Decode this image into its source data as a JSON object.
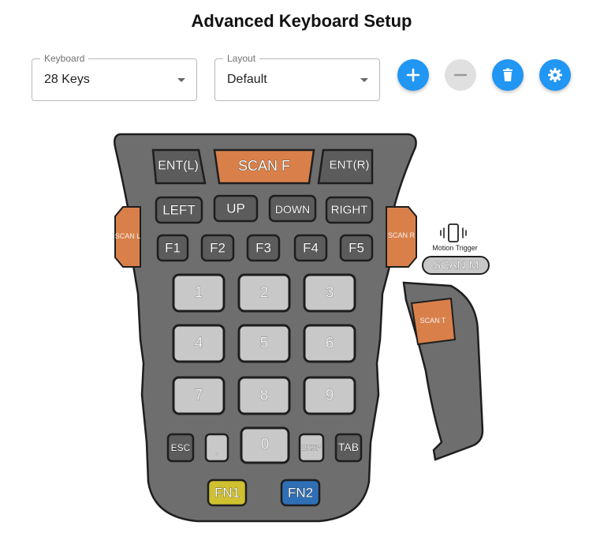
{
  "header": {
    "title": "Advanced Keyboard Setup"
  },
  "controls": {
    "keyboard": {
      "label": "Keyboard",
      "value": "28 Keys"
    },
    "layout": {
      "label": "Layout",
      "value": "Default"
    }
  },
  "actions": {
    "add": {
      "icon": "add-icon",
      "color": "#2196f3"
    },
    "remove": {
      "icon": "remove-icon",
      "color": "#e0e0e0",
      "disabled": true
    },
    "delete": {
      "icon": "trash-icon",
      "color": "#2196f3"
    },
    "settings": {
      "icon": "gear-icon",
      "color": "#2196f3"
    }
  },
  "device": {
    "body_color": "#6e6e6e",
    "scan_color": "#d9804a",
    "keys": {
      "ent_l": "ENT(L)",
      "scan_f": "SCAN F",
      "ent_r": "ENT(R)",
      "left": "LEFT",
      "up": "UP",
      "down": "DOWN",
      "right": "RIGHT",
      "f1": "F1",
      "f2": "F2",
      "f3": "F3",
      "f4": "F4",
      "f5": "F5",
      "n1": "1",
      "n2": "2",
      "n3": "3",
      "n4": "4",
      "n5": "5",
      "n6": "6",
      "n7": "7",
      "n8": "8",
      "n9": "9",
      "esc": "ESC",
      "dot": ".",
      "n0": "0",
      "bksp": "BKSP",
      "tab": "TAB",
      "fn1": "FN1",
      "fn2": "FN2"
    },
    "side": {
      "scan_l": "SCAN L",
      "scan_r": "SCAN R",
      "scan_t": "SCAN T",
      "motion_label": "Motion Trigger",
      "scan_m": "SCAN M"
    },
    "fn_colors": {
      "fn1": "#cfc030",
      "fn2": "#2f6fb5"
    }
  }
}
